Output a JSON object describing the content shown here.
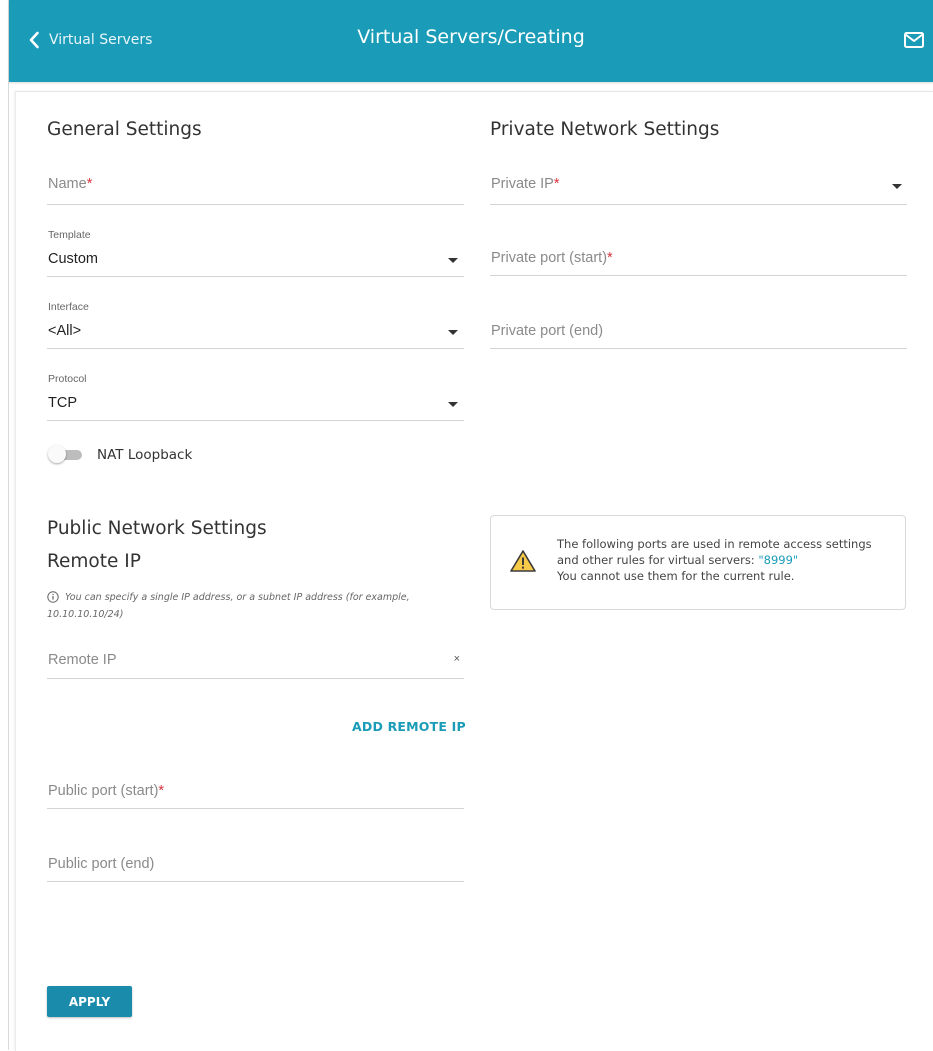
{
  "header": {
    "back_label": "Virtual Servers",
    "title": "Virtual Servers/Creating",
    "accent_color": "#1a9bb8"
  },
  "general": {
    "title": "General Settings",
    "name": {
      "placeholder": "Name",
      "required_mark": "*"
    },
    "template": {
      "label": "Template",
      "value": "Custom"
    },
    "interface": {
      "label": "Interface",
      "value": "<All>"
    },
    "protocol": {
      "label": "Protocol",
      "value": "TCP"
    },
    "nat_loopback": {
      "label": "NAT Loopback",
      "enabled": false
    }
  },
  "public": {
    "title": "Public Network Settings",
    "remote_ip_title": "Remote IP",
    "hint": "You can specify a single IP address, or a subnet IP address (for example, 10.10.10.10/24)",
    "remote_ip": {
      "placeholder": "Remote IP",
      "clear": "×"
    },
    "add_remote_ip": "ADD REMOTE IP",
    "port_start": {
      "placeholder": "Public port (start)",
      "required_mark": "*"
    },
    "port_end": {
      "placeholder": "Public port (end)"
    }
  },
  "private": {
    "title": "Private Network Settings",
    "ip": {
      "placeholder": "Private IP",
      "required_mark": "*"
    },
    "port_start": {
      "placeholder": "Private port (start)",
      "required_mark": "*"
    },
    "port_end": {
      "placeholder": "Private port (end)"
    }
  },
  "warning": {
    "line1": "The following ports are used in remote access settings",
    "line2_prefix": "and other rules for virtual servers: ",
    "ports": "\"8999\"",
    "line3": "You cannot use them for the current rule."
  },
  "apply_label": "APPLY"
}
